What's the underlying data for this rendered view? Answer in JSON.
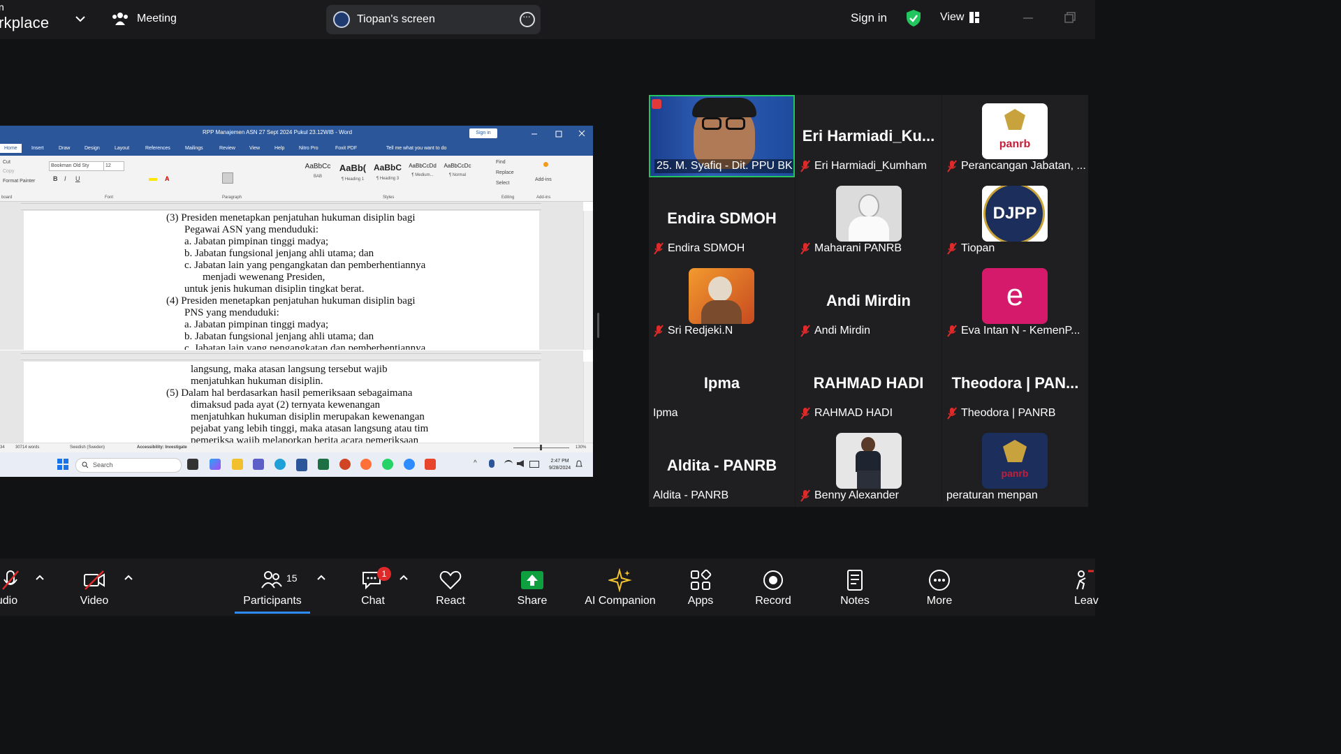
{
  "topbar": {
    "brand_top": "n",
    "brand": "rkplace",
    "meeting_label": "Meeting",
    "screen_label": "Tiopan's screen",
    "sign_in": "Sign in",
    "view_label": "View"
  },
  "word": {
    "title": "RPP Manajemen ASN 27 Sept 2024 Pukul 23.12WIB - Word",
    "sign_in": "Sign in",
    "tabs": [
      "Home",
      "Insert",
      "Draw",
      "Design",
      "Layout",
      "References",
      "Mailings",
      "Review",
      "View",
      "Help",
      "Nitro Pro",
      "Foxit PDF",
      "Tell me what you want to do"
    ],
    "clipboard": [
      "Cut",
      "Copy",
      "Format Painter"
    ],
    "font_name": "Bookman Old Sty",
    "font_size": "12",
    "styles": [
      {
        "preview": "AaBbCc",
        "name": "BAB"
      },
      {
        "preview": "AaBb(",
        "name": "¶ Heading 1"
      },
      {
        "preview": "AaBbC",
        "name": "¶ Heading 3"
      },
      {
        "preview": "AaBbCcDd",
        "name": "¶ Medium..."
      },
      {
        "preview": "AaBbCcDc",
        "name": "¶ Normal"
      }
    ],
    "editing": [
      "Find",
      "Replace",
      "Select"
    ],
    "addins": "Add-ins",
    "groups": [
      "board",
      "Font",
      "Paragraph",
      "Styles",
      "Editing",
      "Add-ins"
    ],
    "pane1_lines": [
      "(3)  Presiden  menetapkan  penjatuhan  hukuman  disiplin  bagi",
      "Pegawai ASN yang menduduki:",
      "a.   Jabatan pimpinan tinggi madya;",
      "b.   Jabatan fungsional jenjang ahli utama; dan",
      "c.   Jabatan lain yang pengangkatan dan pemberhentiannya",
      "menjadi wewenang Presiden,",
      "untuk jenis hukuman disiplin tingkat berat.",
      "(4)  Presiden  menetapkan  penjatuhan  hukuman  disiplin  bagi",
      "PNS yang menduduki:",
      "a.   Jabatan pimpinan tinggi madya;",
      "b.   Jabatan fungsional jenjang ahli utama; dan",
      "c.   Jabatan lain yang pengangkatan dan pemberhentiannya"
    ],
    "pane2_lines": [
      "langsung,    maka    atasan    langsung    tersebut    wajib",
      "menjatuhkan hukuman disiplin.",
      "(5)  Dalam  hal  berdasarkan  hasil  pemeriksaan  sebagaimana",
      "dimaksud    pada    ayat    (2)    ternyata    kewenangan",
      "menjatuhkan  hukuman  disiplin  merupakan  kewenangan",
      "pejabat  yang  lebih  tinggi,  maka  atasan  langsung  atau  tim",
      "pemeriksa  wajib  melaporkan  berita  acara  pemeriksaan"
    ],
    "status": {
      "page": "34",
      "words": "30714 words",
      "language": "Swedish (Sweden)",
      "accessibility": "Accessibility: Investigate",
      "zoom": "130%"
    },
    "taskbar": {
      "search": "Search",
      "time": "2:47 PM",
      "date": "9/28/2024"
    }
  },
  "gallery": [
    {
      "big": "",
      "caption": "25. M. Syafiq - Dit. PPU BK...",
      "muted": false,
      "kind": "video"
    },
    {
      "big": "Eri  Harmiadi_Ku...",
      "caption": "Eri Harmiadi_Kumham",
      "muted": true,
      "kind": "name"
    },
    {
      "big": "",
      "caption": "Perancangan Jabatan, ...",
      "muted": true,
      "kind": "panrb",
      "logo_text": "panrb"
    },
    {
      "big": "Endira SDMOH",
      "caption": "Endira SDMOH",
      "muted": true,
      "kind": "name"
    },
    {
      "big": "",
      "caption": "Maharani PANRB",
      "muted": true,
      "kind": "photo-woman"
    },
    {
      "big": "",
      "caption": "Tiopan",
      "muted": true,
      "kind": "djpp",
      "logo_text": "DJPP"
    },
    {
      "big": "",
      "caption": "Sri Redjeki.N",
      "muted": true,
      "kind": "photo-sri"
    },
    {
      "big": "Andi Mirdin",
      "caption": "Andi Mirdin",
      "muted": true,
      "kind": "name"
    },
    {
      "big": "",
      "caption": "Eva Intan N - KemenP...",
      "muted": true,
      "kind": "letter",
      "letter": "e"
    },
    {
      "big": "Ipma",
      "caption": "Ipma",
      "muted": false,
      "kind": "name"
    },
    {
      "big": "RAHMAD HADI",
      "caption": "RAHMAD HADI",
      "muted": true,
      "kind": "name"
    },
    {
      "big": "Theodora | PAN...",
      "caption": "Theodora | PANRB",
      "muted": true,
      "kind": "name"
    },
    {
      "big": "Aldita - PANRB",
      "caption": "Aldita - PANRB",
      "muted": false,
      "kind": "name"
    },
    {
      "big": "",
      "caption": "Benny Alexander",
      "muted": true,
      "kind": "photo-man"
    },
    {
      "big": "",
      "caption": "peraturan menpan",
      "muted": false,
      "kind": "panrb",
      "logo_text": "panrb"
    }
  ],
  "toolbar": {
    "audio": "udio",
    "video": "Video",
    "participants": "Participants",
    "participants_count": "15",
    "chat": "Chat",
    "chat_badge": "1",
    "react": "React",
    "share": "Share",
    "ai": "AI Companion",
    "apps": "Apps",
    "record": "Record",
    "notes": "Notes",
    "more": "More",
    "leave": "Leav"
  },
  "colors": {
    "accent_green": "#22c55e",
    "share_green": "#0e9f3f",
    "word_blue": "#2b579a",
    "muted_red": "#e02a2a",
    "eva_pink": "#d61a6b",
    "zoom_blue": "#2d8cff"
  }
}
